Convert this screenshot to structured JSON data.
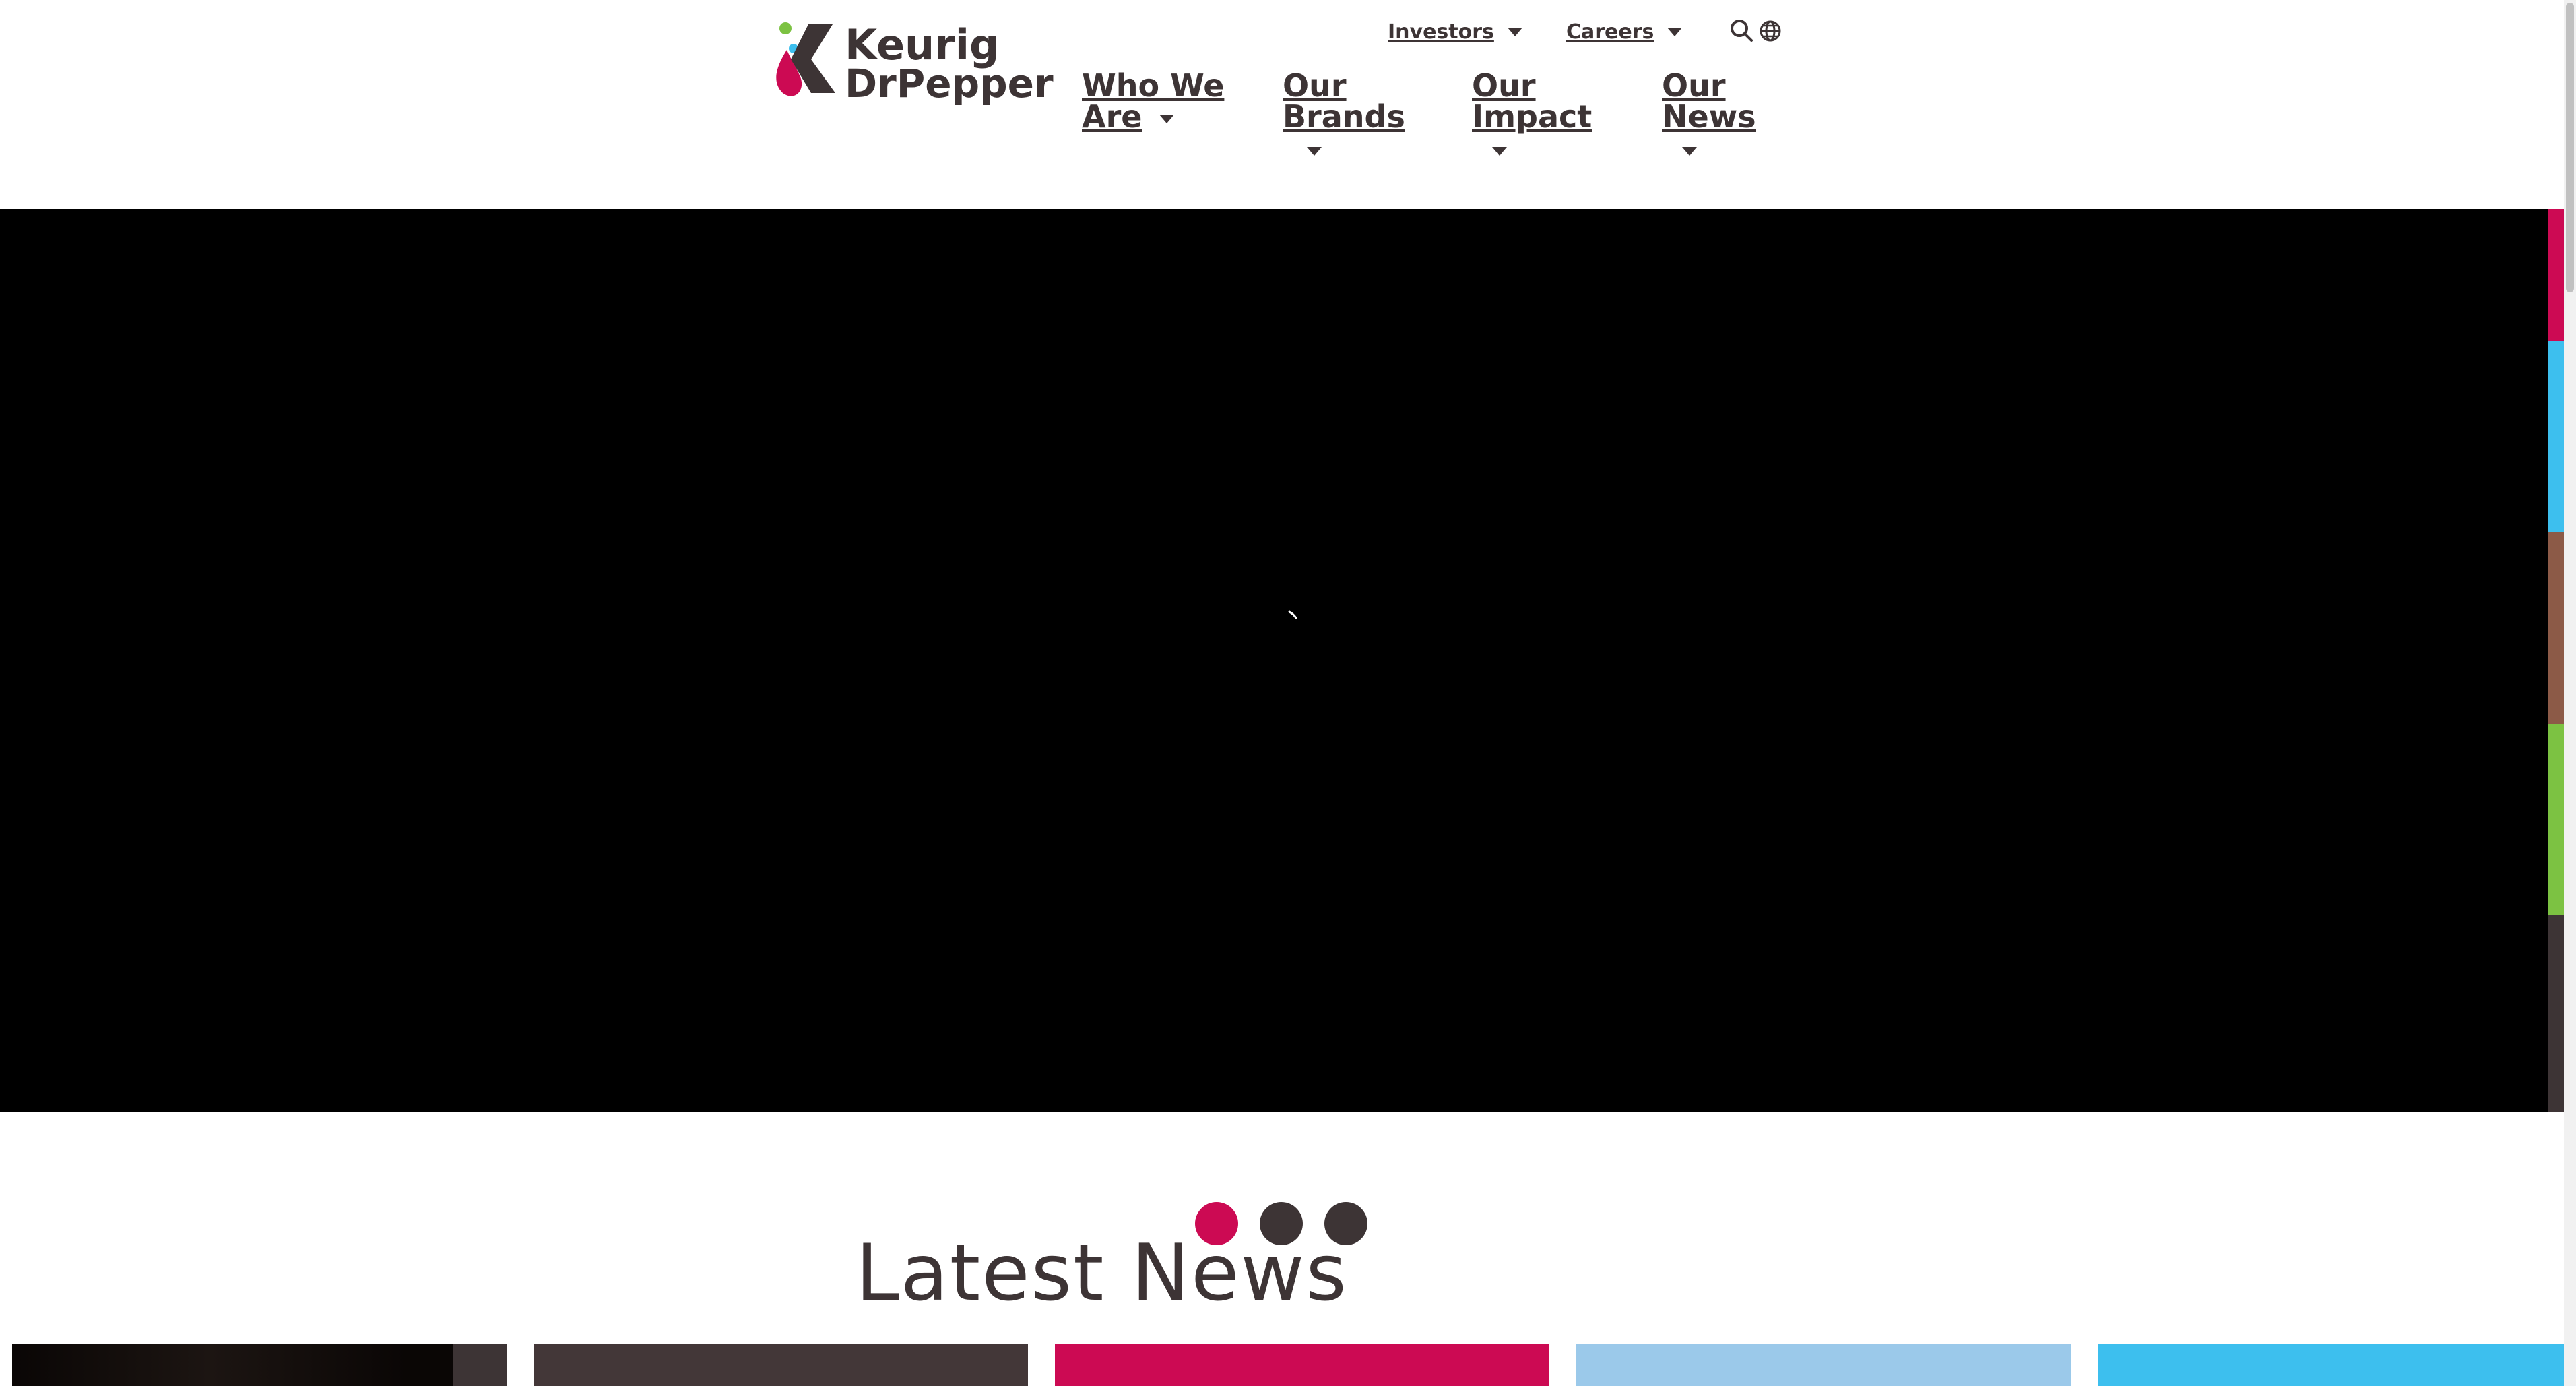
{
  "brand": {
    "logo_line1": "Keurig",
    "logo_line2": "DrPepper",
    "logo_icon": "kdp-logo-icon"
  },
  "utility_nav": {
    "investors": "Investors",
    "careers": "Careers",
    "search_icon": "search-icon",
    "globe_icon": "globe-icon"
  },
  "main_nav": {
    "who_we_are": [
      "Who We",
      "Are"
    ],
    "our_brands": [
      "Our",
      "Brands"
    ],
    "our_impact": [
      "Our",
      "Impact"
    ],
    "our_news": [
      "Our",
      "News"
    ]
  },
  "hero": {
    "loading_icon": "loading-spinner-icon",
    "slides": 3,
    "active_slide": 1
  },
  "colors": {
    "brand_magenta": "#cc0a53",
    "brand_blue": "#3dbfee",
    "brand_brown": "#8c5a47",
    "brand_green": "#7cc242",
    "brand_dark": "#3d3435",
    "light_blue": "#9bc9ea"
  },
  "side_color_bar": [
    "#cc0a53",
    "#3dbfee",
    "#8c5a47",
    "#7cc242",
    "#3d3435"
  ],
  "latest_news": {
    "heading": "Latest News"
  }
}
